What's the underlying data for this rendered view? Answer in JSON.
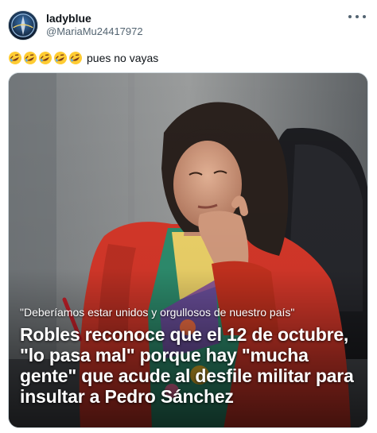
{
  "author": {
    "display_name": "ladyblue",
    "handle": "@MariaMu24417972",
    "avatar_icon": "avatar-image"
  },
  "more_icon": "more-horizontal-icon",
  "tweet": {
    "emojis": [
      "rolling-on-floor-laughing",
      "rolling-on-floor-laughing",
      "rolling-on-floor-laughing",
      "rolling-on-floor-laughing",
      "rolling-on-floor-laughing"
    ],
    "text": "pues no vayas"
  },
  "media": {
    "quote": "\"Deberíamos estar unidos y orgullosos de nuestro país\"",
    "headline": "Robles reconoce que el 12 de octubre, \"lo pasa mal\" porque hay \"mucha gente\" que acude al desfile militar para insultar a Pedro Sánchez"
  },
  "colors": {
    "text_primary": "#0f1419",
    "text_secondary": "#536471",
    "border": "#cfd9de",
    "jacket_red": "#d8382a"
  }
}
